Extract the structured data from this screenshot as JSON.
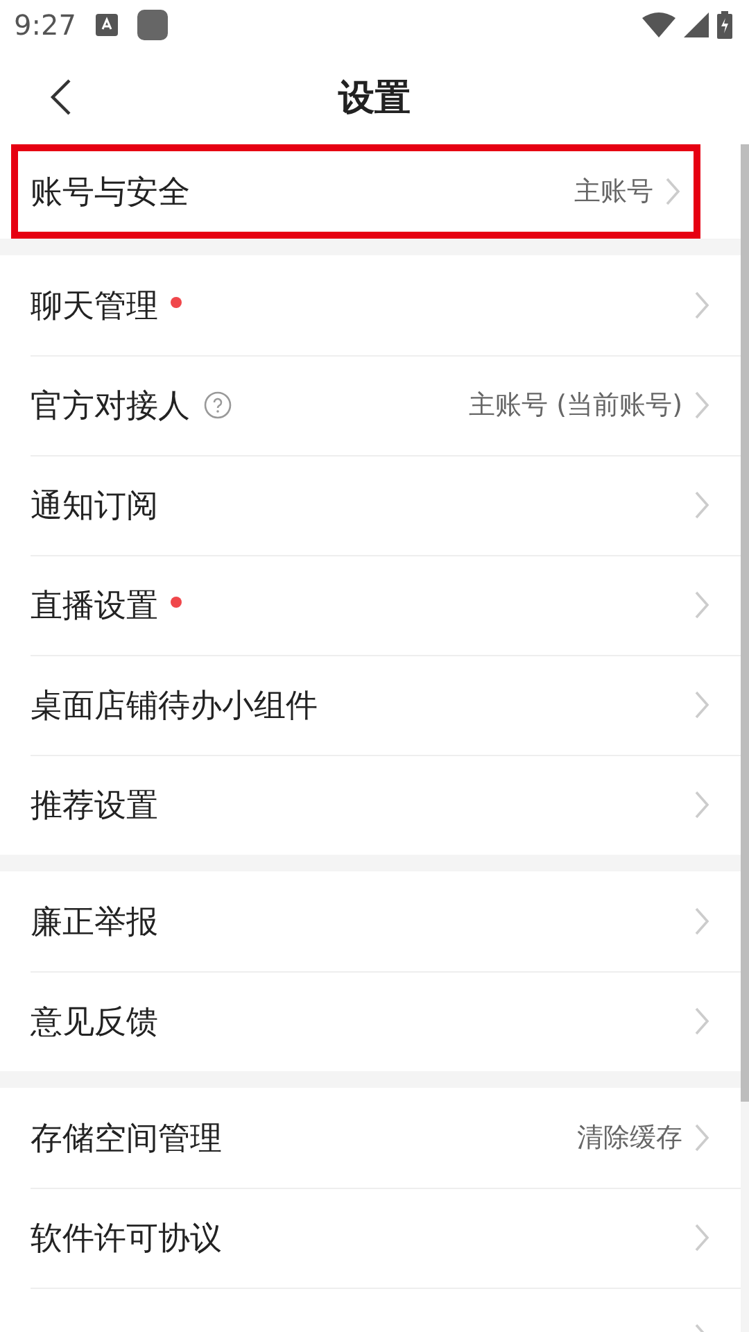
{
  "status_bar": {
    "time": "9:27"
  },
  "header": {
    "title": "设置"
  },
  "groups": [
    {
      "items": [
        {
          "label": "账号与安全",
          "value": "主账号",
          "dot": false,
          "help": false,
          "highlighted": true
        }
      ]
    },
    {
      "items": [
        {
          "label": "聊天管理",
          "dot": true,
          "help": false,
          "highlighted": false
        },
        {
          "label": "官方对接人",
          "value": "主账号 (当前账号)",
          "dot": false,
          "help": true,
          "highlighted": false
        },
        {
          "label": "通知订阅",
          "dot": false,
          "help": false,
          "highlighted": false
        },
        {
          "label": "直播设置",
          "dot": true,
          "help": false,
          "highlighted": false
        },
        {
          "label": "桌面店铺待办小组件",
          "dot": false,
          "help": false,
          "highlighted": false
        },
        {
          "label": "推荐设置",
          "dot": false,
          "help": false,
          "highlighted": false
        }
      ]
    },
    {
      "items": [
        {
          "label": "廉正举报",
          "dot": false,
          "help": false,
          "highlighted": false
        },
        {
          "label": "意见反馈",
          "dot": false,
          "help": false,
          "highlighted": false
        }
      ]
    },
    {
      "items": [
        {
          "label": "存储空间管理",
          "value": "清除缓存",
          "dot": false,
          "help": false,
          "highlighted": false
        },
        {
          "label": "软件许可协议",
          "dot": false,
          "help": false,
          "highlighted": false
        },
        {
          "dot": false,
          "help": false,
          "highlighted": false
        }
      ]
    }
  ]
}
